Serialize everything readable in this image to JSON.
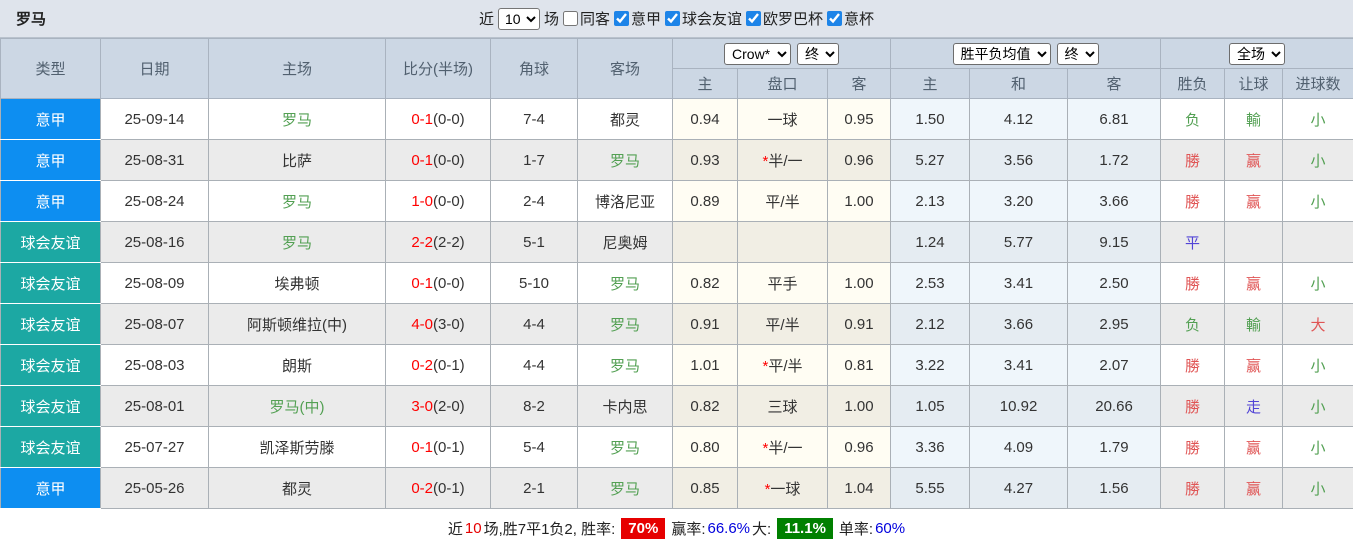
{
  "topbar": {
    "title": "罗马",
    "recent_label": "近",
    "recent_value": "10",
    "games_label": "场",
    "same_venue": {
      "label": "同客",
      "checked": false
    },
    "filters": [
      {
        "label": "意甲",
        "checked": true
      },
      {
        "label": "球会友谊",
        "checked": true
      },
      {
        "label": "欧罗巴杯",
        "checked": true
      },
      {
        "label": "意杯",
        "checked": true
      }
    ]
  },
  "table": {
    "main_headers": [
      "类型",
      "日期",
      "主场",
      "比分(半场)",
      "角球",
      "客场"
    ],
    "selects": {
      "odds_company": "Crow*",
      "odds_stage": "终",
      "avg_type": "胜平负均值",
      "avg_stage": "终",
      "scope": "全场"
    },
    "subheaders": [
      "主",
      "盘口",
      "客",
      "主",
      "和",
      "客",
      "胜负",
      "让球",
      "进球数"
    ],
    "rows": [
      {
        "league": "意甲",
        "league_class": "type-league",
        "date": "25-09-14",
        "home": "罗马",
        "home_class": "c-green",
        "score": "0-1",
        "half": "(0-0)",
        "corner": "7-4",
        "away": "都灵",
        "away_class": "",
        "odds_home": "0.94",
        "handicap_star": "",
        "handicap": "一球",
        "odds_away": "0.95",
        "avg_win": "1.50",
        "avg_draw": "4.12",
        "avg_lose": "6.81",
        "result": "负",
        "result_class": "c-green",
        "let_result": "輸",
        "let_class": "c-green",
        "goals": "小",
        "goals_class": "c-green"
      },
      {
        "league": "意甲",
        "league_class": "type-league",
        "date": "25-08-31",
        "home": "比萨",
        "home_class": "",
        "score": "0-1",
        "half": "(0-0)",
        "corner": "1-7",
        "away": "罗马",
        "away_class": "c-green",
        "odds_home": "0.93",
        "handicap_star": "*",
        "handicap": "半/一",
        "odds_away": "0.96",
        "avg_win": "5.27",
        "avg_draw": "3.56",
        "avg_lose": "1.72",
        "result": "勝",
        "result_class": "c-red",
        "let_result": "赢",
        "let_class": "c-red",
        "goals": "小",
        "goals_class": "c-green"
      },
      {
        "league": "意甲",
        "league_class": "type-league",
        "date": "25-08-24",
        "home": "罗马",
        "home_class": "c-green",
        "score": "1-0",
        "half": "(0-0)",
        "corner": "2-4",
        "away": "博洛尼亚",
        "away_class": "",
        "odds_home": "0.89",
        "handicap_star": "",
        "handicap": "平/半",
        "odds_away": "1.00",
        "avg_win": "2.13",
        "avg_draw": "3.20",
        "avg_lose": "3.66",
        "result": "勝",
        "result_class": "c-red",
        "let_result": "赢",
        "let_class": "c-red",
        "goals": "小",
        "goals_class": "c-green"
      },
      {
        "league": "球会友谊",
        "league_class": "type-friendly",
        "date": "25-08-16",
        "home": "罗马",
        "home_class": "c-green",
        "score": "2-2",
        "half": "(2-2)",
        "corner": "5-1",
        "away": "尼奥姆",
        "away_class": "",
        "odds_home": "",
        "handicap_star": "",
        "handicap": "",
        "odds_away": "",
        "avg_win": "1.24",
        "avg_draw": "5.77",
        "avg_lose": "9.15",
        "result": "平",
        "result_class": "c-purple",
        "let_result": "",
        "let_class": "",
        "goals": "",
        "goals_class": ""
      },
      {
        "league": "球会友谊",
        "league_class": "type-friendly",
        "date": "25-08-09",
        "home": "埃弗顿",
        "home_class": "",
        "score": "0-1",
        "half": "(0-0)",
        "corner": "5-10",
        "away": "罗马",
        "away_class": "c-green",
        "odds_home": "0.82",
        "handicap_star": "",
        "handicap": "平手",
        "odds_away": "1.00",
        "avg_win": "2.53",
        "avg_draw": "3.41",
        "avg_lose": "2.50",
        "result": "勝",
        "result_class": "c-red",
        "let_result": "赢",
        "let_class": "c-red",
        "goals": "小",
        "goals_class": "c-green"
      },
      {
        "league": "球会友谊",
        "league_class": "type-friendly",
        "date": "25-08-07",
        "home": "阿斯顿维拉(中)",
        "home_class": "",
        "score": "4-0",
        "half": "(3-0)",
        "corner": "4-4",
        "away": "罗马",
        "away_class": "c-green",
        "odds_home": "0.91",
        "handicap_star": "",
        "handicap": "平/半",
        "odds_away": "0.91",
        "avg_win": "2.12",
        "avg_draw": "3.66",
        "avg_lose": "2.95",
        "result": "负",
        "result_class": "c-green",
        "let_result": "輸",
        "let_class": "c-green",
        "goals": "大",
        "goals_class": "c-red"
      },
      {
        "league": "球会友谊",
        "league_class": "type-friendly",
        "date": "25-08-03",
        "home": "朗斯",
        "home_class": "",
        "score": "0-2",
        "half": "(0-1)",
        "corner": "4-4",
        "away": "罗马",
        "away_class": "c-green",
        "odds_home": "1.01",
        "handicap_star": "*",
        "handicap": "平/半",
        "odds_away": "0.81",
        "avg_win": "3.22",
        "avg_draw": "3.41",
        "avg_lose": "2.07",
        "result": "勝",
        "result_class": "c-red",
        "let_result": "赢",
        "let_class": "c-red",
        "goals": "小",
        "goals_class": "c-green"
      },
      {
        "league": "球会友谊",
        "league_class": "type-friendly",
        "date": "25-08-01",
        "home": "罗马(中)",
        "home_class": "c-green",
        "score": "3-0",
        "half": "(2-0)",
        "corner": "8-2",
        "away": "卡内思",
        "away_class": "",
        "odds_home": "0.82",
        "handicap_star": "",
        "handicap": "三球",
        "odds_away": "1.00",
        "avg_win": "1.05",
        "avg_draw": "10.92",
        "avg_lose": "20.66",
        "result": "勝",
        "result_class": "c-red",
        "let_result": "走",
        "let_class": "c-purple",
        "goals": "小",
        "goals_class": "c-green"
      },
      {
        "league": "球会友谊",
        "league_class": "type-friendly",
        "date": "25-07-27",
        "home": "凯泽斯劳滕",
        "home_class": "",
        "score": "0-1",
        "half": "(0-1)",
        "corner": "5-4",
        "away": "罗马",
        "away_class": "c-green",
        "odds_home": "0.80",
        "handicap_star": "*",
        "handicap": "半/一",
        "odds_away": "0.96",
        "avg_win": "3.36",
        "avg_draw": "4.09",
        "avg_lose": "1.79",
        "result": "勝",
        "result_class": "c-red",
        "let_result": "赢",
        "let_class": "c-red",
        "goals": "小",
        "goals_class": "c-green"
      },
      {
        "league": "意甲",
        "league_class": "type-league",
        "date": "25-05-26",
        "home": "都灵",
        "home_class": "",
        "score": "0-2",
        "half": "(0-1)",
        "corner": "2-1",
        "away": "罗马",
        "away_class": "c-green",
        "odds_home": "0.85",
        "handicap_star": "*",
        "handicap": "一球",
        "odds_away": "1.04",
        "avg_win": "5.55",
        "avg_draw": "4.27",
        "avg_lose": "1.56",
        "result": "勝",
        "result_class": "c-red",
        "let_result": "赢",
        "let_class": "c-red",
        "goals": "小",
        "goals_class": "c-green"
      }
    ]
  },
  "footer": {
    "prefix": "近",
    "count": "10",
    "record": "场,胜7平1负2, 胜率:",
    "win_rate": "70%",
    "handicap_label": " 赢率:",
    "handicap_rate": "66.6%",
    "big_label": " 大:",
    "big_rate": "11.1%",
    "odd_label": " 单率:",
    "odd_rate": "60%"
  },
  "colors": {
    "league_blue": "#0d8ef1",
    "friendly_teal": "#1ca8a3",
    "win_red": "#e05555",
    "loss_green": "#53a053",
    "draw_purple": "#5244d6",
    "score_red": "#ff0000",
    "rate_blue": "#0000dd",
    "badge_red": "#e60000",
    "badge_green": "#008000",
    "header_bg": "#ccd7e4",
    "topbar_bg": "#dfe4ec"
  }
}
